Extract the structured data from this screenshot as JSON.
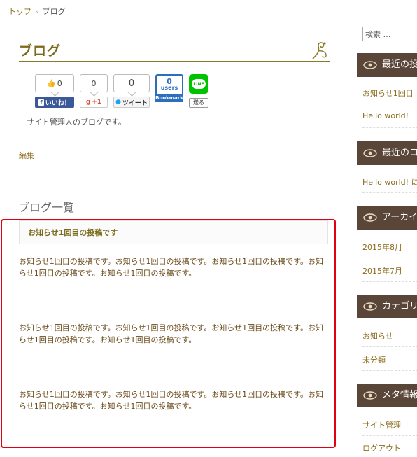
{
  "breadcrumb": {
    "home": "トップ",
    "current": "ブログ"
  },
  "page": {
    "title": "ブログ",
    "description": "サイト管理人のブログです。",
    "edit_link": "編集",
    "section_heading": "ブログ一覧"
  },
  "social": {
    "fb_count": "0",
    "fb_label": "いいね！",
    "gplus_count": "0",
    "gplus_label": "+1",
    "tw_count": "0",
    "tw_label": "ツイート",
    "hatena_count": "0",
    "hatena_users": "users",
    "hatena_label": "Bookmark",
    "line_icon_text": "LINE",
    "line_label": "送る"
  },
  "post": {
    "title": "お知らせ1回目の投稿です",
    "paragraphs": [
      "お知らせ1回目の投稿です。お知らせ1回目の投稿です。お知らせ1回目の投稿です。お知らせ1回目の投稿です。お知らせ1回目の投稿です。",
      "お知らせ1回目の投稿です。お知らせ1回目の投稿です。お知らせ1回目の投稿です。お知らせ1回目の投稿です。お知らせ1回目の投稿です。",
      "お知らせ1回目の投稿です。お知らせ1回目の投稿です。お知らせ1回目の投稿です。お知らせ1回目の投稿です。お知らせ1回目の投稿です。"
    ]
  },
  "sidebar": {
    "search_value": "検索 …",
    "widgets": [
      {
        "title": "最近の投",
        "items": [
          "お知らせ1回目",
          "Hello world!"
        ]
      },
      {
        "title": "最近のコ",
        "items": [
          "Hello world! に"
        ]
      },
      {
        "title": "アーカイ",
        "items": [
          "2015年8月",
          "2015年7月"
        ]
      },
      {
        "title": "カテゴリ",
        "items": [
          "お知らせ",
          "未分類"
        ]
      },
      {
        "title": "メタ情報",
        "items": [
          "サイト管理",
          "ログアウト"
        ]
      }
    ]
  },
  "colors": {
    "accent": "#8a6b1b",
    "title": "#7a6a1a",
    "widget_header": "#5a4638",
    "highlight": "#e0000f"
  }
}
